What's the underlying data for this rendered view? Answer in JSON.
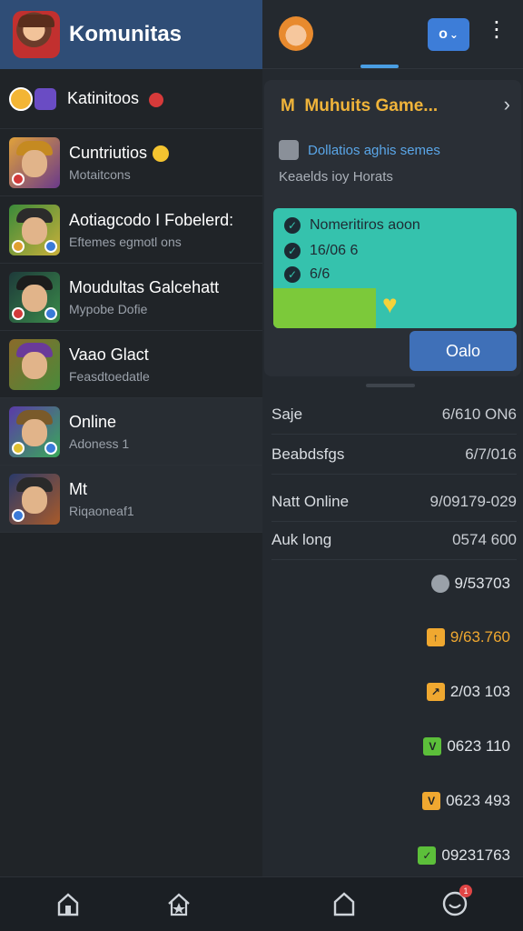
{
  "app": {
    "title": "Komunitas"
  },
  "list": [
    {
      "title": "Katinitoos",
      "sub": ""
    },
    {
      "title": "Cuntriutios",
      "sub": "Motaitcons"
    },
    {
      "title": "Aotiagcodo I Fobelerd:",
      "sub": "Eftemes egmotl ons"
    },
    {
      "title": "Moudultas Galcehatt",
      "sub": "Mypobe Dofie"
    },
    {
      "title": "Vaao Glact",
      "sub": "Feasdtoedatle"
    },
    {
      "title": "Online",
      "sub": "Adoness 1"
    },
    {
      "title": "Mt",
      "sub": "Riqaoneaf1"
    }
  ],
  "header": {
    "lang_button": "o",
    "more": "⋮"
  },
  "card": {
    "title": "M  Muhuits Game...",
    "checkbox_label": "Dollatios aghis semes",
    "subtitle": "Keaelds ioy Horats",
    "lines": [
      "Nomeritiros  aoon",
      "16/06 6",
      "6/6"
    ],
    "button": "Oalo",
    "progress_fraction": 0.42
  },
  "stats": [
    {
      "label": "Saje",
      "value": "6/610 ON6"
    },
    {
      "label": "Beabdsfgs",
      "value": "6/7/016"
    },
    {
      "label": "Natt Online",
      "value": "9/09179-029"
    },
    {
      "label": "Auk long",
      "value": "0574 600"
    }
  ],
  "values": [
    {
      "value": "9/53703",
      "badge": "",
      "color": "#9aa1a9"
    },
    {
      "value": "9/63.760",
      "badge": "↑",
      "color": "#f0a830"
    },
    {
      "value": "2/03 103",
      "badge": "↗",
      "color": "#f0a830"
    },
    {
      "value": "0623 110",
      "badge": "V",
      "color": "#5cbf3a"
    },
    {
      "value": "0623 493",
      "badge": "V",
      "color": "#f0a830"
    },
    {
      "value": "09231763",
      "badge": "✓",
      "color": "#5cbf3a"
    }
  ],
  "notif_count": "1",
  "icons": {
    "nav": [
      "home-icon",
      "star-house-icon",
      "bookmark-icon",
      "profile-icon"
    ]
  },
  "colors": {
    "accent": "#3d7dd8",
    "header": "#2f4d76",
    "teal": "#35c2ad",
    "green": "#7cc93a",
    "gold": "#f0b43a"
  }
}
